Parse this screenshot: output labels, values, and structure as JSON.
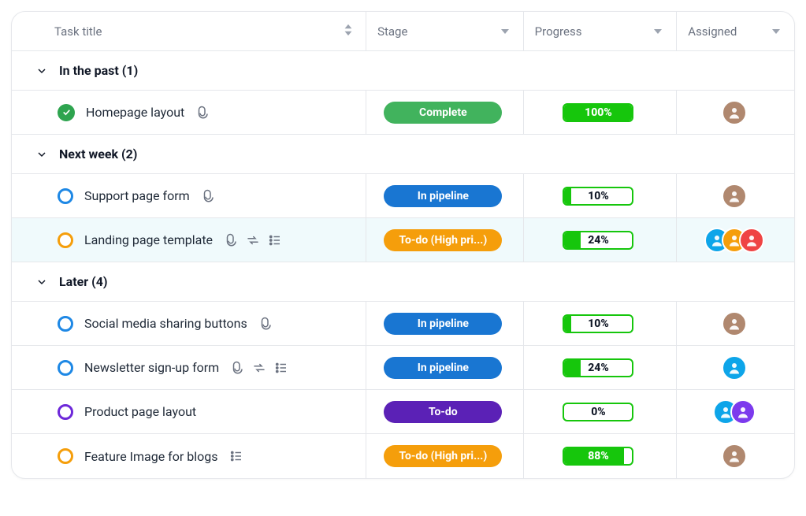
{
  "columns": {
    "title": "Task title",
    "stage": "Stage",
    "progress": "Progress",
    "assigned": "Assigned"
  },
  "stageColors": {
    "Complete": "green",
    "In pipeline": "blue",
    "To-do (High pri...)": "orange",
    "To-do": "purple"
  },
  "statusColors": {
    "done": "done",
    "pipeline": "blue",
    "todo-high": "orange",
    "todo": "purple"
  },
  "groups": [
    {
      "label": "In the past (1)",
      "tasks": [
        {
          "title": "Homepage layout",
          "status": "done",
          "icons": [
            "attachment"
          ],
          "stage": "Complete",
          "progress": 100,
          "assignees": [
            {
              "bg": "#b0886f"
            }
          ]
        }
      ]
    },
    {
      "label": "Next week (2)",
      "tasks": [
        {
          "title": "Support page form",
          "status": "pipeline",
          "icons": [
            "attachment"
          ],
          "stage": "In pipeline",
          "progress": 10,
          "assignees": [
            {
              "bg": "#b0886f"
            }
          ]
        },
        {
          "title": "Landing page template",
          "status": "todo-high",
          "icons": [
            "attachment",
            "repeat",
            "list"
          ],
          "stage": "To-do (High pri...)",
          "progress": 24,
          "highlight": true,
          "assignees": [
            {
              "bg": "#0ea5e9"
            },
            {
              "bg": "#f59e0b"
            },
            {
              "bg": "#ef4444"
            }
          ]
        }
      ]
    },
    {
      "label": "Later (4)",
      "tasks": [
        {
          "title": "Social media sharing buttons",
          "status": "pipeline",
          "icons": [
            "attachment"
          ],
          "stage": "In pipeline",
          "progress": 10,
          "assignees": [
            {
              "bg": "#b0886f"
            }
          ]
        },
        {
          "title": "Newsletter sign-up form",
          "status": "pipeline",
          "icons": [
            "attachment",
            "repeat",
            "list"
          ],
          "stage": "In pipeline",
          "progress": 24,
          "assignees": [
            {
              "bg": "#0ea5e9"
            }
          ]
        },
        {
          "title": "Product page layout",
          "status": "todo",
          "icons": [],
          "stage": "To-do",
          "progress": 0,
          "assignees": [
            {
              "bg": "#0ea5e9"
            },
            {
              "bg": "#7c3aed"
            }
          ]
        },
        {
          "title": "Feature Image for blogs",
          "status": "todo-high",
          "icons": [
            "list"
          ],
          "stage": "To-do (High pri...)",
          "progress": 88,
          "assignees": [
            {
              "bg": "#b0886f"
            }
          ]
        }
      ]
    }
  ]
}
